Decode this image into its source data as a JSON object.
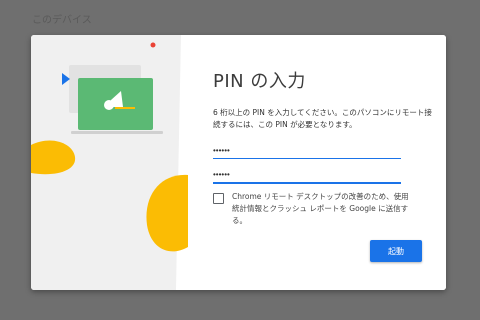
{
  "background": {
    "title": "このデバイス"
  },
  "dialog": {
    "title": "PIN の入力",
    "description": "6 桁以上の PIN を入力してください。このパソコンにリモート接続するには、この PIN が必要となります。",
    "pin_value": "••••••",
    "pin_confirm_value": "••••••",
    "checkbox_label": "Chrome リモート デスクトップの改善のため、使用統計情報とクラッシュ レポートを Google に送信する。",
    "checkbox_checked": false,
    "submit_label": "起動"
  },
  "colors": {
    "accent": "#1a73e8",
    "illustration_green": "#5bb974",
    "illustration_yellow": "#fbbc04",
    "illustration_red": "#ea4335"
  },
  "icons": [
    "play-arrow-icon",
    "laptop-icon",
    "chrome-remote-desktop-icon"
  ]
}
